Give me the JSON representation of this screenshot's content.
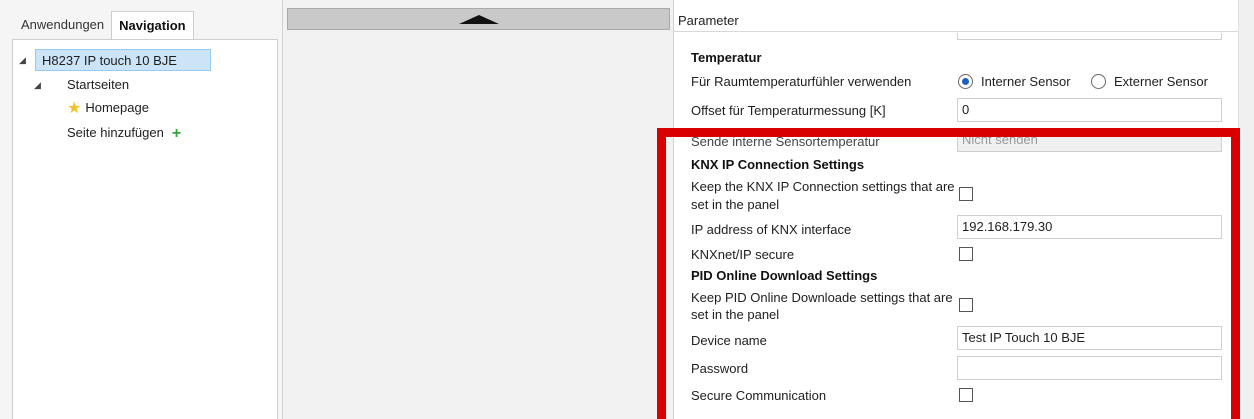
{
  "left_panel": {
    "tabs": [
      {
        "label": "Anwendungen",
        "active": false
      },
      {
        "label": "Navigation",
        "active": true
      }
    ],
    "tree": {
      "root": "H8237 IP touch 10 BJE",
      "group": "Startseiten",
      "page": "Homepage",
      "add_page": "Seite hinzufügen"
    }
  },
  "parameters": {
    "title": "Parameter",
    "temperature": {
      "heading": "Temperatur",
      "sensor_label": "Für Raumtemperaturfühler verwenden",
      "sensor_options": [
        "Interner Sensor",
        "Externer Sensor"
      ],
      "sensor_selected": "Interner Sensor",
      "offset_label": "Offset für Temperaturmessung [K]",
      "offset_value": "0",
      "send_label": "Sende interne Sensortemperatur",
      "send_value": "Nicht senden"
    },
    "knx": {
      "heading": "KNX IP Connection Settings",
      "keep_label_line1": "Keep the KNX IP Connection settings that are",
      "keep_label_line2": "set in the panel",
      "keep_checked": false,
      "ip_label": "IP address of KNX interface",
      "ip_value": "192.168.179.30",
      "secure_label": "KNXnet/IP secure",
      "secure_checked": false
    },
    "pid": {
      "heading": "PID Online Download Settings",
      "keep_label_line1": "Keep PID Online Downloade settings that are",
      "keep_label_line2": "set in the panel",
      "keep_checked": false,
      "device_label": "Device name",
      "device_value": "Test IP Touch 10 BJE",
      "password_label": "Password",
      "password_value": "",
      "secure_comm_label": "Secure Communication",
      "secure_comm_checked": false
    }
  },
  "colors": {
    "highlight": "#d80000",
    "selection": "#cce4f7",
    "radio_dot": "#1f5fbf",
    "add_icon": "#2fa83a",
    "star_icon": "#f2c12e"
  }
}
